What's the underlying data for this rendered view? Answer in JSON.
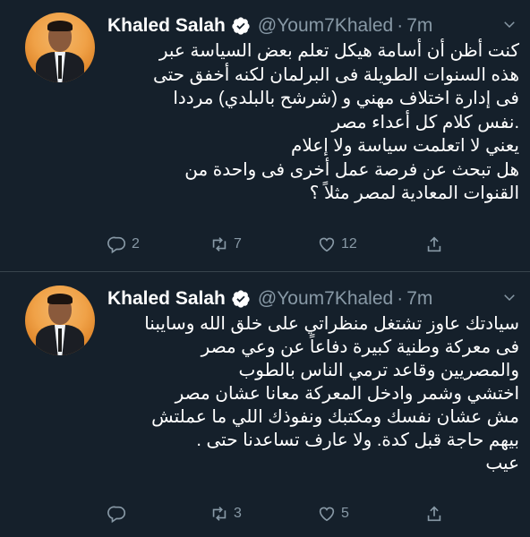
{
  "tweets": [
    {
      "name": "Khaled Salah",
      "handle": "@Youm7Khaled",
      "dot": "·",
      "time": "7m",
      "lines": [
        "كنت أظن أن أسامة هيكل تعلم بعض السياسة عبر",
        "هذه السنوات الطويلة فى البرلمان لكنه أخفق حتى",
        "فى إدارة اختلاف مهني و (شرشح بالبلدي) مرددا",
        ".نفس كلام كل أعداء مصر",
        "يعني لا اتعلمت سياسة ولا إعلام",
        "هل تبحث عن فرصة عمل أخرى فى واحدة من",
        "القنوات المعادية لمصر مثلاً ؟"
      ],
      "reply_count": "2",
      "retweet_count": "7",
      "like_count": "12"
    },
    {
      "name": "Khaled Salah",
      "handle": "@Youm7Khaled",
      "dot": "·",
      "time": "7m",
      "lines": [
        "سيادتك عاوز تشتغل منظراتي على خلق الله وسايبنا",
        "فى معركة وطنية كبيرة دفاعاً عن وعي مصر",
        "والمصريين وقاعد ترمي الناس بالطوب",
        "اختشي وشمر وادخل المعركة معانا عشان مصر",
        "مش عشان نفسك ومكتبك ونفوذك اللي ما عملتش",
        "بيهم حاجة قبل كدة. ولا عارف تساعدنا حتى .",
        "عيب"
      ],
      "reply_count": "",
      "retweet_count": "3",
      "like_count": "5"
    }
  ],
  "colors": {
    "background": "#15202b",
    "secondary_text": "#8899a6",
    "verified_blue": "#1da1f2",
    "divider": "#38444d"
  },
  "icons": [
    "verified-icon",
    "chevron-down-icon",
    "reply-icon",
    "retweet-icon",
    "like-icon",
    "share-icon"
  ]
}
